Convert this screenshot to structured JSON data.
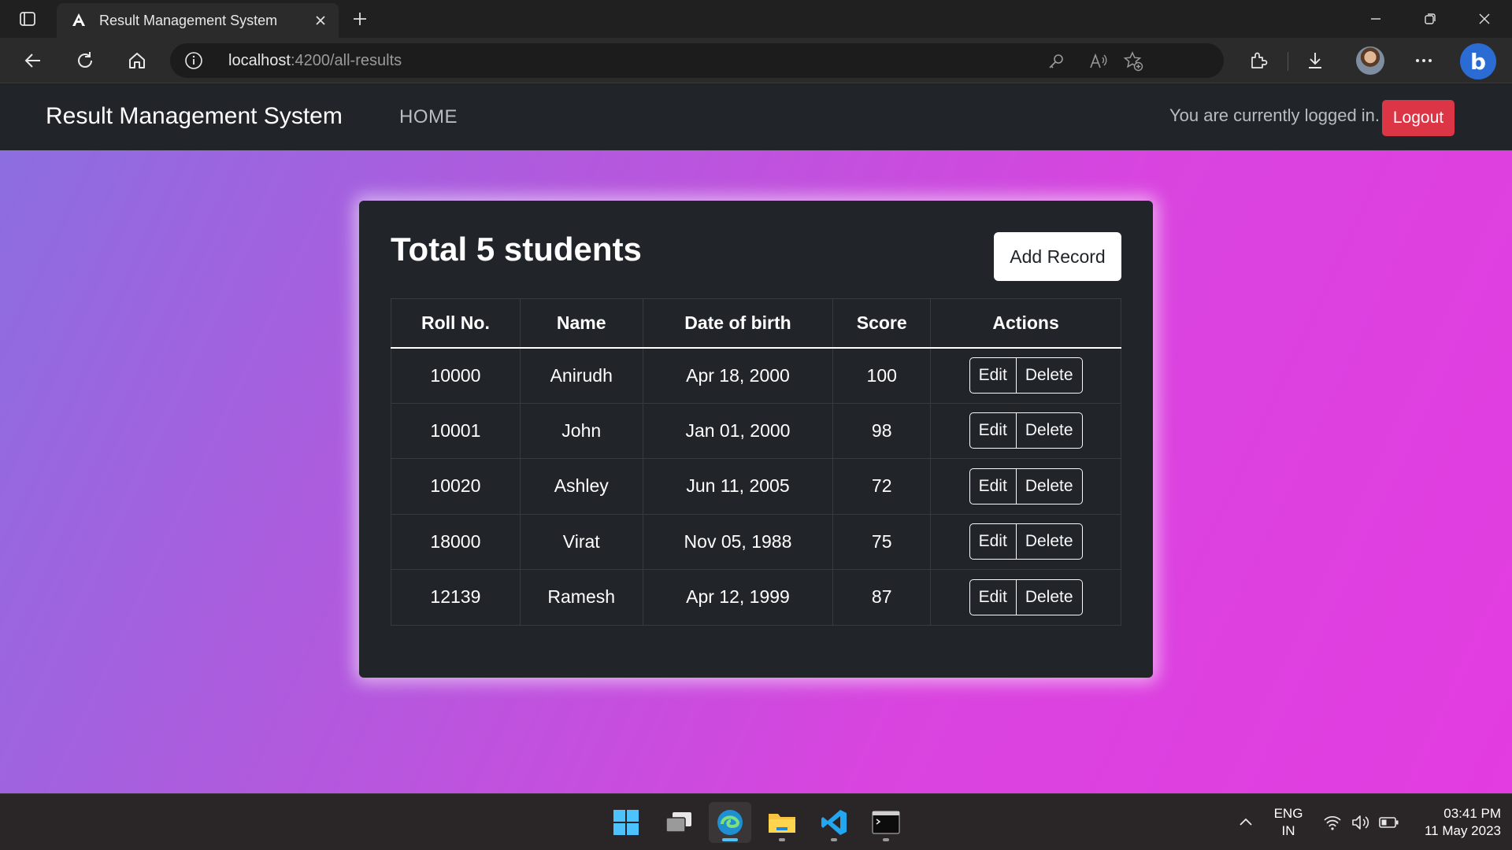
{
  "browser": {
    "tab_title": "Result Management System",
    "address_host": "localhost",
    "address_path": ":4200/all-results"
  },
  "navbar": {
    "brand": "Result Management System",
    "home_link": "HOME",
    "status_text": "You are currently logged in.",
    "logout_label": "Logout"
  },
  "main": {
    "title": "Total 5 students",
    "add_record_label": "Add Record",
    "columns": [
      "Roll No.",
      "Name",
      "Date of birth",
      "Score",
      "Actions"
    ],
    "rows": [
      {
        "roll": "10000",
        "name": "Anirudh",
        "dob": "Apr 18, 2000",
        "score": "100"
      },
      {
        "roll": "10001",
        "name": "John",
        "dob": "Jan 01, 2000",
        "score": "98"
      },
      {
        "roll": "10020",
        "name": "Ashley",
        "dob": "Jun 11, 2005",
        "score": "72"
      },
      {
        "roll": "18000",
        "name": "Virat",
        "dob": "Nov 05, 1988",
        "score": "75"
      },
      {
        "roll": "12139",
        "name": "Ramesh",
        "dob": "Apr 12, 1999",
        "score": "87"
      }
    ],
    "edit_label": "Edit",
    "delete_label": "Delete"
  },
  "taskbar": {
    "lang_line1": "ENG",
    "lang_line2": "IN",
    "time": "03:41 PM",
    "date": "11 May 2023"
  },
  "colors": {
    "navbar_bg": "#212529",
    "card_bg": "#212529",
    "logout_red": "#dc3545",
    "page_gradient_start": "#8a6fe0",
    "page_gradient_end": "#e33ce0"
  }
}
